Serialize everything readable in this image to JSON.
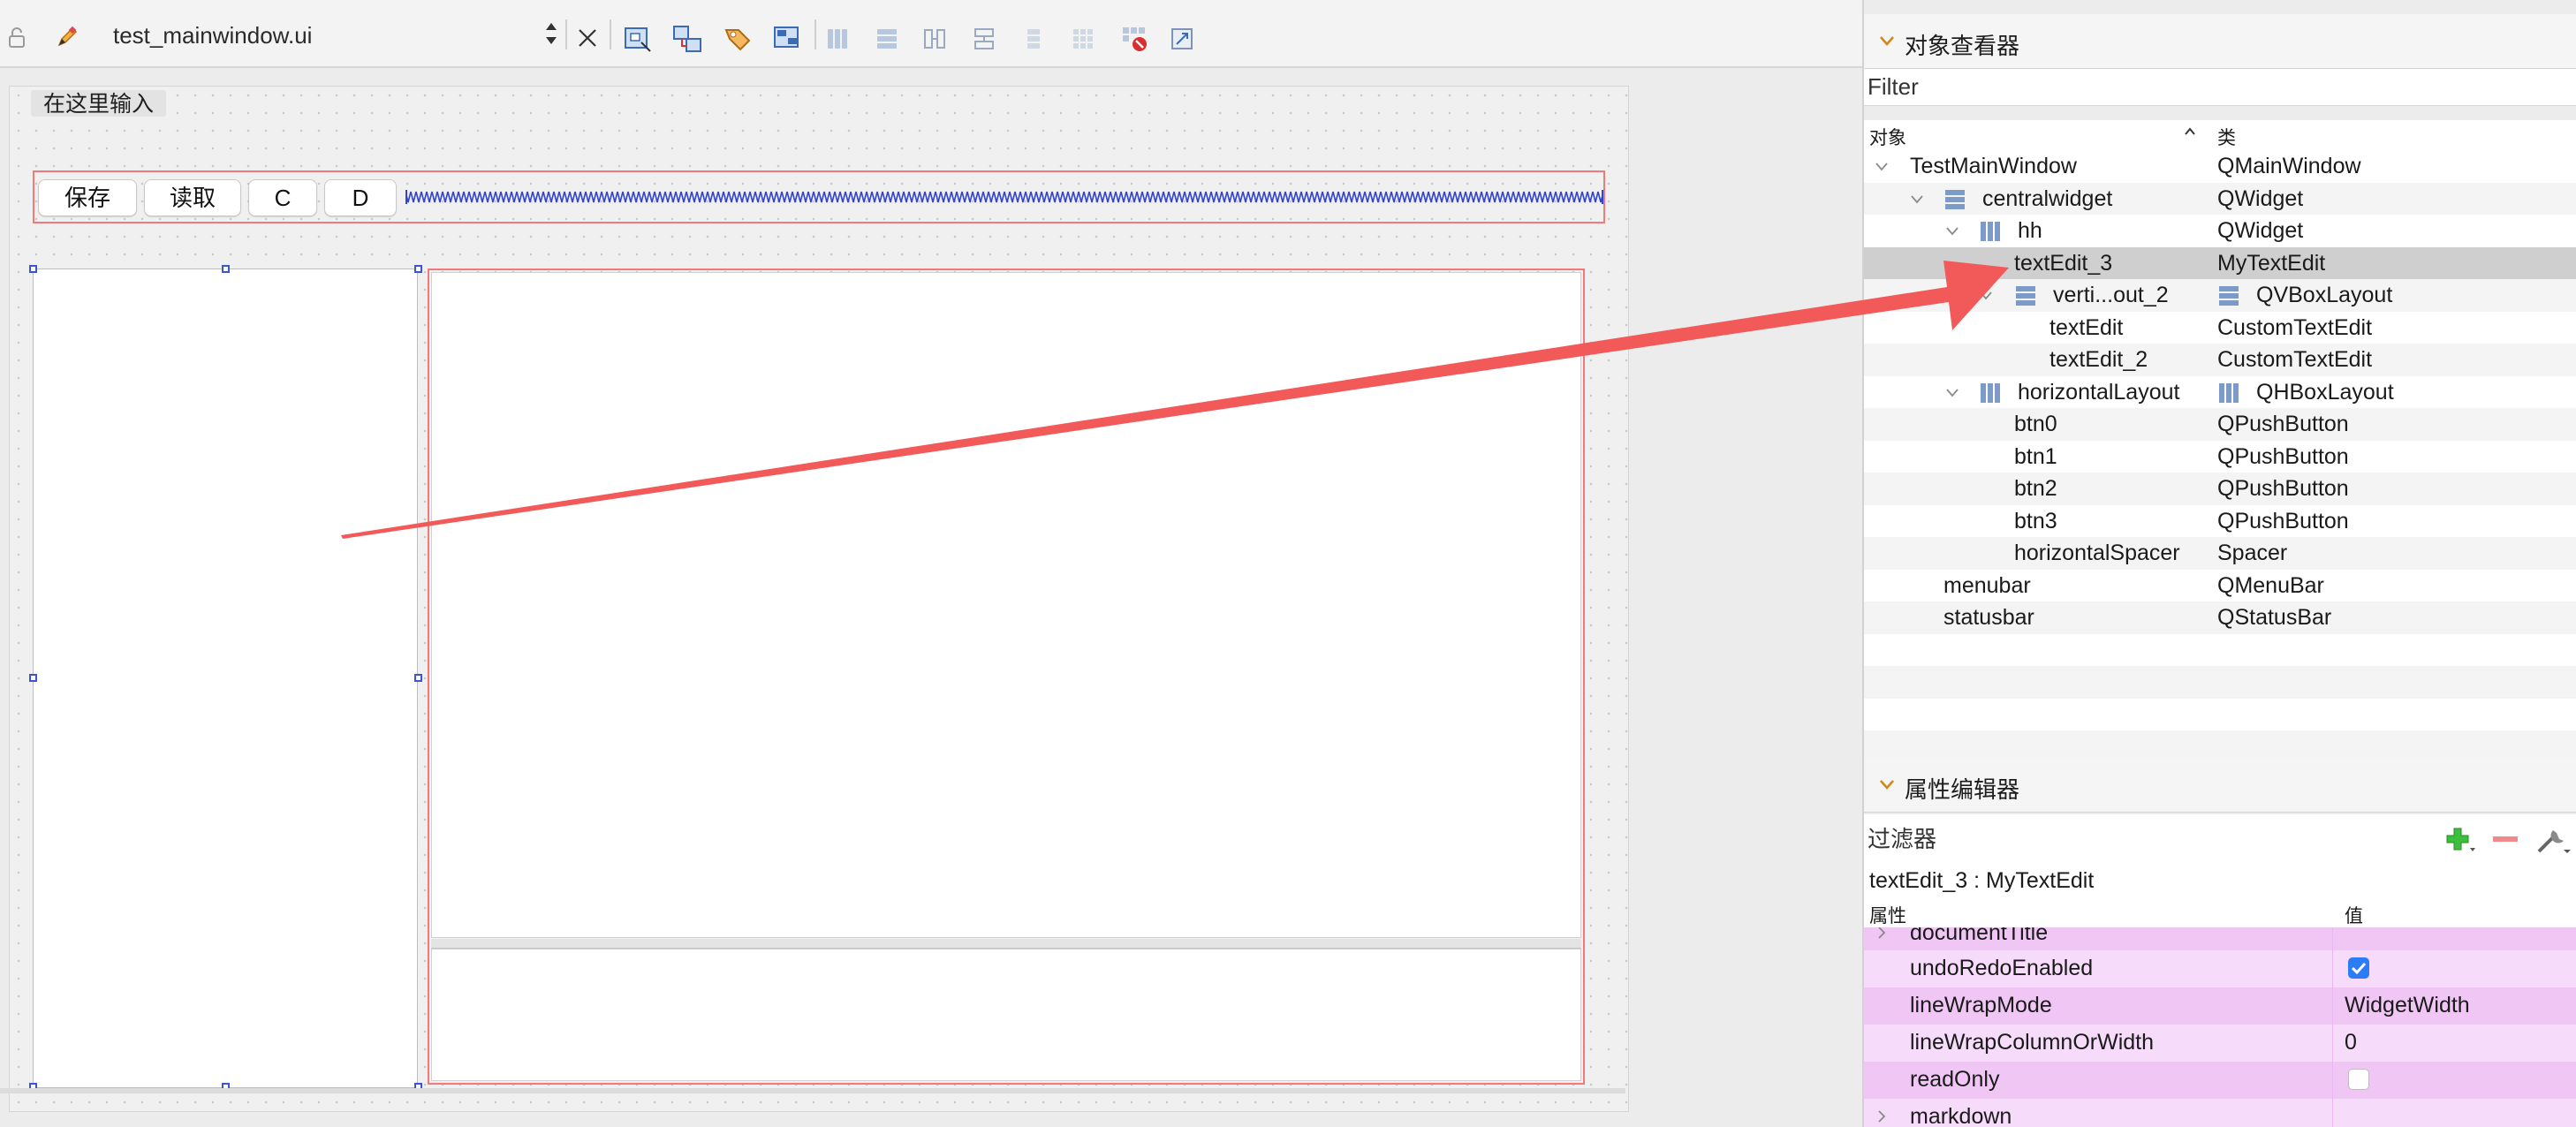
{
  "toolbar": {
    "file_name": "test_mainwindow.ui"
  },
  "form": {
    "menu_placeholder": "在这里输入",
    "buttons": [
      "保存",
      "读取",
      "C",
      "D"
    ]
  },
  "object_inspector": {
    "title": "对象查看器",
    "filter_placeholder": "Filter",
    "col_object": "对象",
    "col_class": "类",
    "rows": [
      {
        "name": "TestMainWindow",
        "cls": "QMainWindow"
      },
      {
        "name": "centralwidget",
        "cls": "QWidget"
      },
      {
        "name": "hh",
        "cls": "QWidget"
      },
      {
        "name": "textEdit_3",
        "cls": "MyTextEdit"
      },
      {
        "name": "verti...out_2",
        "cls": "QVBoxLayout"
      },
      {
        "name": "textEdit",
        "cls": "CustomTextEdit"
      },
      {
        "name": "textEdit_2",
        "cls": "CustomTextEdit"
      },
      {
        "name": "horizontalLayout",
        "cls": "QHBoxLayout"
      },
      {
        "name": "btn0",
        "cls": "QPushButton"
      },
      {
        "name": "btn1",
        "cls": "QPushButton"
      },
      {
        "name": "btn2",
        "cls": "QPushButton"
      },
      {
        "name": "btn3",
        "cls": "QPushButton"
      },
      {
        "name": "horizontalSpacer",
        "cls": "Spacer"
      },
      {
        "name": "menubar",
        "cls": "QMenuBar"
      },
      {
        "name": "statusbar",
        "cls": "QStatusBar"
      }
    ]
  },
  "property_editor": {
    "title": "属性编辑器",
    "filter_placeholder": "过滤器",
    "target": "textEdit_3 : MyTextEdit",
    "col_property": "属性",
    "col_value": "值",
    "rows": [
      {
        "name": "documentTitle",
        "value": ""
      },
      {
        "name": "undoRedoEnabled",
        "value": ""
      },
      {
        "name": "lineWrapMode",
        "value": "WidgetWidth"
      },
      {
        "name": "lineWrapColumnOrWidth",
        "value": "0"
      },
      {
        "name": "readOnly",
        "value": ""
      },
      {
        "name": "markdown",
        "value": ""
      }
    ]
  },
  "colors": {
    "selection": "#cfcfcf",
    "layout_border": "#f07a7a",
    "property_pink": "#f0c6f5",
    "property_pink_light": "#f7dbfa",
    "checkbox_blue": "#2c7cf6",
    "arrow": "#f25a5a"
  }
}
